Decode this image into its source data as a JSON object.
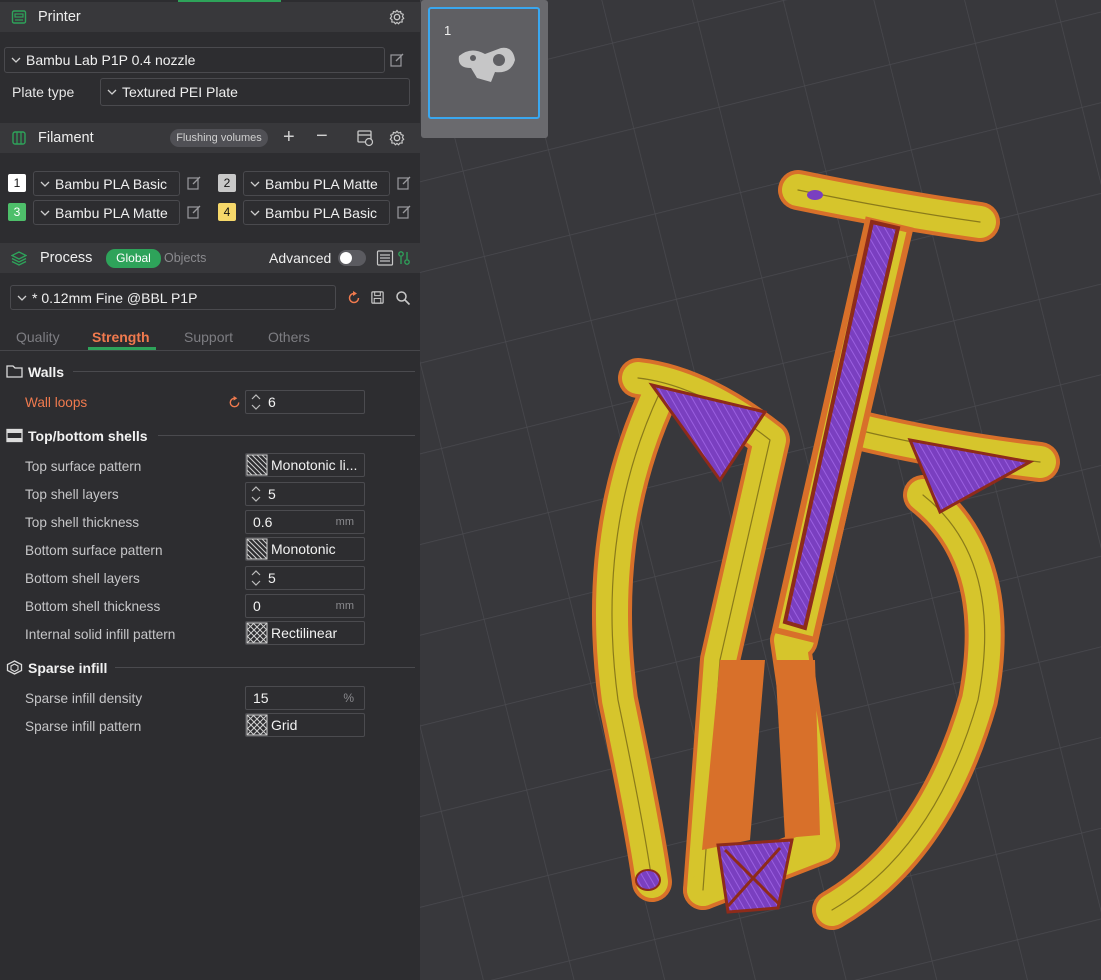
{
  "printer": {
    "title": "Printer",
    "model": "Bambu Lab P1P 0.4 nozzle",
    "plate_type_label": "Plate type",
    "plate_type_value": "Textured PEI Plate"
  },
  "filament": {
    "title": "Filament",
    "flushing_label": "Flushing volumes",
    "slots": [
      {
        "num": "1",
        "name": "Bambu PLA Basic",
        "color": "#ffffff",
        "text_color": "#111111"
      },
      {
        "num": "2",
        "name": "Bambu PLA Matte",
        "color": "#c8c8c8",
        "text_color": "#111111"
      },
      {
        "num": "3",
        "name": "Bambu PLA Matte",
        "color": "#4ebf6a",
        "text_color": "#ffffff"
      },
      {
        "num": "4",
        "name": "Bambu PLA Basic",
        "color": "#f6d86a",
        "text_color": "#111111"
      }
    ]
  },
  "process": {
    "title": "Process",
    "global_label": "Global",
    "objects_label": "Objects",
    "advanced_label": "Advanced",
    "advanced_enabled": false,
    "preset": "* 0.12mm Fine @BBL P1P",
    "tabs": [
      "Quality",
      "Strength",
      "Support",
      "Others"
    ],
    "active_tab": "Strength"
  },
  "strength": {
    "walls_title": "Walls",
    "wall_loops_label": "Wall loops",
    "wall_loops_value": "6",
    "shells_title": "Top/bottom shells",
    "top_surface_pattern_label": "Top surface pattern",
    "top_surface_pattern_value": "Monotonic li...",
    "top_shell_layers_label": "Top shell layers",
    "top_shell_layers_value": "5",
    "top_shell_thickness_label": "Top shell thickness",
    "top_shell_thickness_value": "0.6",
    "bottom_surface_pattern_label": "Bottom surface pattern",
    "bottom_surface_pattern_value": "Monotonic",
    "bottom_shell_layers_label": "Bottom shell layers",
    "bottom_shell_layers_value": "5",
    "bottom_shell_thickness_label": "Bottom shell thickness",
    "bottom_shell_thickness_value": "0",
    "internal_solid_pattern_label": "Internal solid infill pattern",
    "internal_solid_pattern_value": "Rectilinear",
    "sparse_title": "Sparse infill",
    "sparse_density_label": "Sparse infill density",
    "sparse_density_value": "15",
    "sparse_pattern_label": "Sparse infill pattern",
    "sparse_pattern_value": "Grid",
    "unit_mm": "mm",
    "unit_pct": "%"
  },
  "plate": {
    "thumbnail_number": "1"
  },
  "colors": {
    "accent_green": "#2ea35a",
    "accent_orange": "#f07a4e",
    "panel_bg": "#2d2d30",
    "viewport_bg": "#38383c"
  }
}
